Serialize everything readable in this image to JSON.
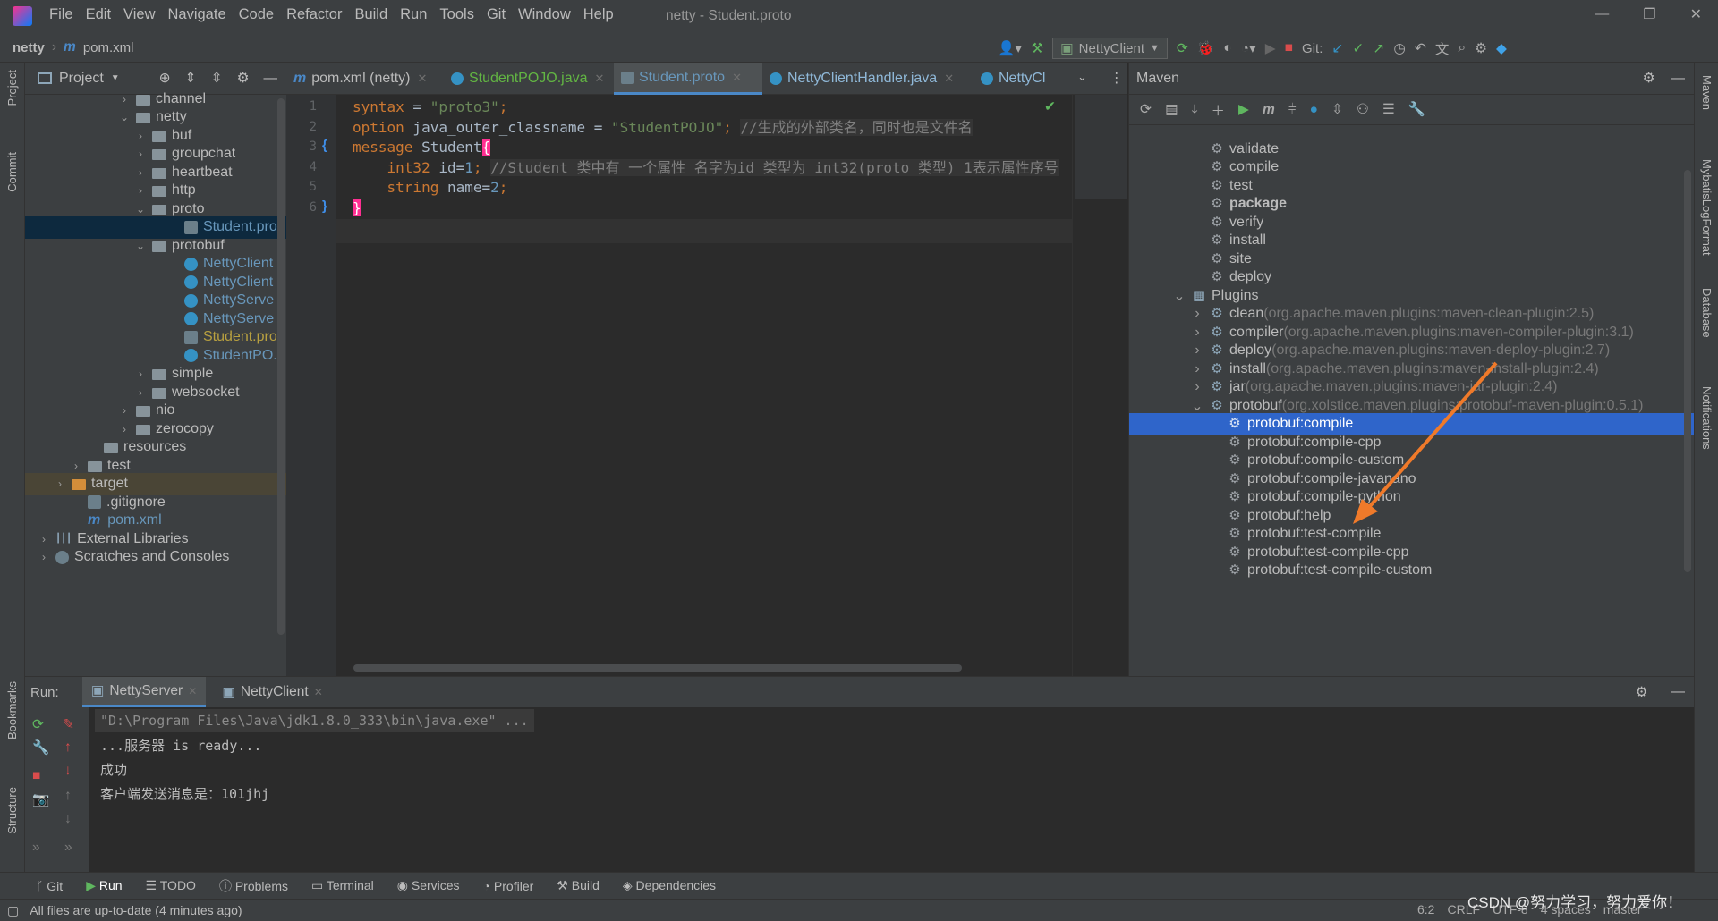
{
  "app": {
    "title": "netty - Student.proto"
  },
  "menu": [
    "File",
    "Edit",
    "View",
    "Navigate",
    "Code",
    "Refactor",
    "Build",
    "Run",
    "Tools",
    "Git",
    "Window",
    "Help"
  ],
  "nav": {
    "project": "netty",
    "file": "pom.xml",
    "run_config": "NettyClient",
    "git_label": "Git:"
  },
  "project_panel": {
    "title": "Project",
    "tree": [
      {
        "label": "channel",
        "kind": "folder",
        "arrow": "›"
      },
      {
        "label": "netty",
        "kind": "folder",
        "arrow": "⌄"
      },
      {
        "label": "buf",
        "kind": "folder",
        "arrow": "›"
      },
      {
        "label": "groupchat",
        "kind": "folder",
        "arrow": "›"
      },
      {
        "label": "heartbeat",
        "kind": "folder",
        "arrow": "›"
      },
      {
        "label": "http",
        "kind": "folder",
        "arrow": "›"
      },
      {
        "label": "proto",
        "kind": "folder",
        "arrow": "⌄"
      },
      {
        "label": "Student.pro",
        "kind": "proto",
        "arrow": ""
      },
      {
        "label": "protobuf",
        "kind": "folder",
        "arrow": "⌄"
      },
      {
        "label": "NettyClient",
        "kind": "class",
        "arrow": ""
      },
      {
        "label": "NettyClient",
        "kind": "class",
        "arrow": ""
      },
      {
        "label": "NettyServe",
        "kind": "class",
        "arrow": ""
      },
      {
        "label": "NettyServe",
        "kind": "class",
        "arrow": ""
      },
      {
        "label": "Student.pro",
        "kind": "proto2",
        "arrow": ""
      },
      {
        "label": "StudentPO.",
        "kind": "class",
        "arrow": ""
      },
      {
        "label": "simple",
        "kind": "folder",
        "arrow": "›"
      },
      {
        "label": "websocket",
        "kind": "folder",
        "arrow": "›"
      },
      {
        "label": "nio",
        "kind": "folder",
        "arrow": "›"
      },
      {
        "label": "zerocopy",
        "kind": "folder",
        "arrow": "›"
      },
      {
        "label": "resources",
        "kind": "folder",
        "arrow": ""
      },
      {
        "label": "test",
        "kind": "folder",
        "arrow": "›"
      },
      {
        "label": "target",
        "kind": "folder-orange",
        "arrow": "›"
      },
      {
        "label": ".gitignore",
        "kind": "file",
        "arrow": ""
      },
      {
        "label": "pom.xml",
        "kind": "maven",
        "arrow": ""
      },
      {
        "label": "External Libraries",
        "kind": "lib",
        "arrow": "›"
      },
      {
        "label": "Scratches and Consoles",
        "kind": "scratch",
        "arrow": "›"
      }
    ]
  },
  "editor": {
    "tabs": [
      "pom.xml (netty)",
      "StudentPOJO.java",
      "Student.proto",
      "NettyClientHandler.java",
      "NettyCl"
    ],
    "lines": [
      {
        "n": "1",
        "parts": [
          {
            "t": "syntax",
            "c": "kw"
          },
          {
            "t": " = ",
            "c": "pl"
          },
          {
            "t": "\"proto3\"",
            "c": "str"
          },
          {
            "t": ";",
            "c": "kw"
          }
        ]
      },
      {
        "n": "2",
        "parts": [
          {
            "t": "option",
            "c": "kw"
          },
          {
            "t": " java_outer_classname = ",
            "c": "pl"
          },
          {
            "t": "\"StudentPOJO\"",
            "c": "str"
          },
          {
            "t": "; ",
            "c": "kw"
          },
          {
            "t": "//生成的外部类名，同时也是文件名",
            "c": "cm"
          }
        ]
      },
      {
        "n": "3",
        "parts": [
          {
            "t": "message",
            "c": "kw"
          },
          {
            "t": " Student",
            "c": "pl"
          },
          {
            "t": "{",
            "c": "brace"
          }
        ]
      },
      {
        "n": "4",
        "parts": [
          {
            "t": "    int32",
            "c": "kw"
          },
          {
            "t": " id=",
            "c": "pl"
          },
          {
            "t": "1",
            "c": "num"
          },
          {
            "t": "; ",
            "c": "kw"
          },
          {
            "t": "//Student 类中有 一个属性 名字为id 类型为 int32(proto 类型) 1表示属性序号",
            "c": "cm"
          }
        ]
      },
      {
        "n": "5",
        "parts": [
          {
            "t": "    string",
            "c": "kw"
          },
          {
            "t": " name=",
            "c": "pl"
          },
          {
            "t": "2",
            "c": "num"
          },
          {
            "t": ";",
            "c": "kw"
          }
        ]
      },
      {
        "n": "6",
        "parts": [
          {
            "t": "}",
            "c": "brace"
          }
        ]
      }
    ]
  },
  "maven": {
    "title": "Maven",
    "items": [
      {
        "label": "validate",
        "detail": "",
        "kind": "goal",
        "indent": 1
      },
      {
        "label": "compile",
        "detail": "",
        "kind": "goal",
        "indent": 1
      },
      {
        "label": "test",
        "detail": "",
        "kind": "goal",
        "indent": 1
      },
      {
        "label": "package",
        "detail": "",
        "kind": "goal-bold",
        "indent": 1
      },
      {
        "label": "verify",
        "detail": "",
        "kind": "goal",
        "indent": 1
      },
      {
        "label": "install",
        "detail": "",
        "kind": "goal",
        "indent": 1
      },
      {
        "label": "site",
        "detail": "",
        "kind": "goal",
        "indent": 1
      },
      {
        "label": "deploy",
        "detail": "",
        "kind": "goal",
        "indent": 1
      },
      {
        "label": "Plugins",
        "detail": "",
        "kind": "plugins",
        "indent": 0
      },
      {
        "label": "clean",
        "detail": " (org.apache.maven.plugins:maven-clean-plugin:2.5)",
        "kind": "plugin",
        "indent": 1
      },
      {
        "label": "compiler",
        "detail": " (org.apache.maven.plugins:maven-compiler-plugin:3.1)",
        "kind": "plugin",
        "indent": 1
      },
      {
        "label": "deploy",
        "detail": " (org.apache.maven.plugins:maven-deploy-plugin:2.7)",
        "kind": "plugin",
        "indent": 1
      },
      {
        "label": "install",
        "detail": " (org.apache.maven.plugins:maven-install-plugin:2.4)",
        "kind": "plugin",
        "indent": 1
      },
      {
        "label": "jar",
        "detail": " (org.apache.maven.plugins:maven-jar-plugin:2.4)",
        "kind": "plugin",
        "indent": 1
      },
      {
        "label": "protobuf",
        "detail": " (org.xolstice.maven.plugins:protobuf-maven-plugin:0.5.1)",
        "kind": "plugin-open",
        "indent": 1
      },
      {
        "label": "protobuf:compile",
        "detail": "",
        "kind": "goal-selected",
        "indent": 2
      },
      {
        "label": "protobuf:compile-cpp",
        "detail": "",
        "kind": "goal",
        "indent": 2
      },
      {
        "label": "protobuf:compile-custom",
        "detail": "",
        "kind": "goal",
        "indent": 2
      },
      {
        "label": "protobuf:compile-javanano",
        "detail": "",
        "kind": "goal",
        "indent": 2
      },
      {
        "label": "protobuf:compile-python",
        "detail": "",
        "kind": "goal",
        "indent": 2
      },
      {
        "label": "protobuf:help",
        "detail": "",
        "kind": "goal",
        "indent": 2
      },
      {
        "label": "protobuf:test-compile",
        "detail": "",
        "kind": "goal",
        "indent": 2
      },
      {
        "label": "protobuf:test-compile-cpp",
        "detail": "",
        "kind": "goal",
        "indent": 2
      },
      {
        "label": "protobuf:test-compile-custom",
        "detail": "",
        "kind": "goal",
        "indent": 2
      }
    ]
  },
  "run": {
    "label": "Run:",
    "tabs": [
      "NettyServer",
      "NettyClient"
    ],
    "console": [
      "\"D:\\Program Files\\Java\\jdk1.8.0_333\\bin\\java.exe\" ...",
      "...服务器 is ready...",
      "成功",
      "客户端发送消息是：101jhj"
    ]
  },
  "bottom_tools": [
    "Git",
    "Run",
    "TODO",
    "Problems",
    "Terminal",
    "Services",
    "Profiler",
    "Build",
    "Dependencies"
  ],
  "side_labels": {
    "left": [
      "Project",
      "Commit",
      "Bookmarks",
      "Structure"
    ],
    "right": [
      "Maven",
      "MybatisLogFormat",
      "Database",
      "Notifications"
    ]
  },
  "status": {
    "message": "All files are up-to-date (4 minutes ago)",
    "position": "6:2",
    "line_sep": "CRLF",
    "encoding": "UTF-8",
    "indent": "4 spaces",
    "branch": "master",
    "watermark": "CSDN @努力学习，努力爱你！"
  },
  "colors": {
    "keyword": "#cc7832",
    "string": "#6a8759",
    "comment": "#808080",
    "number": "#6897bb",
    "selection": "#2f65ca",
    "arrow": "#f07a2a"
  }
}
